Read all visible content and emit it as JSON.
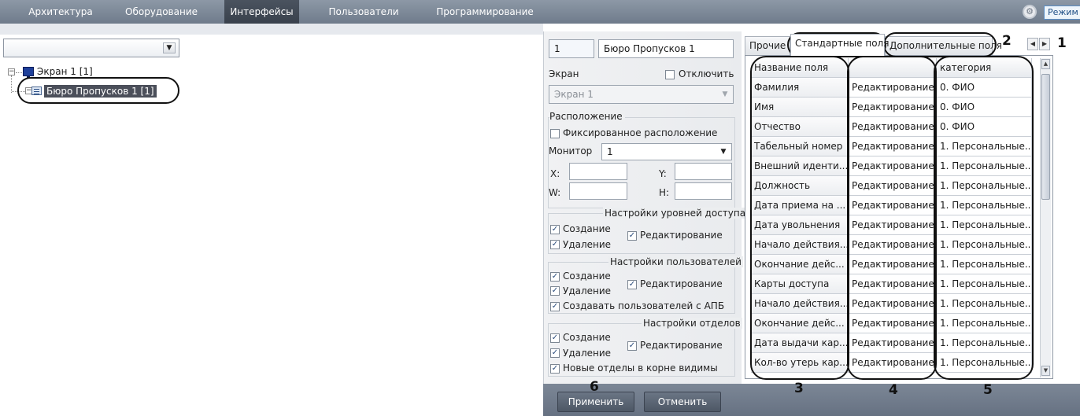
{
  "nav": {
    "tabs": [
      {
        "label": "Архитектура"
      },
      {
        "label": "Оборудование"
      },
      {
        "label": "Интерфейсы"
      },
      {
        "label": "Пользователи"
      },
      {
        "label": "Программирование"
      }
    ],
    "mode_label": "Режим",
    "mode_icon": "gear-icon"
  },
  "tree": {
    "combo_value": "",
    "items": [
      {
        "label": "Экран 1 [1]",
        "icon": "screen-icon"
      },
      {
        "label": "Бюро Пропусков 1 [1]",
        "icon": "list-icon"
      }
    ]
  },
  "settings": {
    "id_value": "1",
    "name_value": "Бюро Пропусков 1",
    "screen_label": "Экран",
    "disable_label": "Отключить",
    "screen_value": "Экран 1",
    "location_group": "Расположение",
    "fixed_location_label": "Фиксированное расположение",
    "monitor_label": "Монитор",
    "monitor_value": "1",
    "x_label": "X:",
    "y_label": "Y:",
    "w_label": "W:",
    "h_label": "H:",
    "access_group": "Настройки уровней доступа",
    "users_group": "Настройки пользователей",
    "departments_group": "Настройки отделов",
    "create_label": "Создание",
    "delete_label": "Удаление",
    "edit_label": "Редактирование",
    "create_users_apb_label": "Создавать пользователей с АПБ",
    "new_departments_root_label": "Новые отделы в корне видимы",
    "apply_label": "Применить",
    "cancel_label": "Отменить"
  },
  "tabs": {
    "items": [
      {
        "label": "Прочие"
      },
      {
        "label": "Стандартные поля"
      },
      {
        "label": "Дополнительные поля"
      }
    ],
    "active": "Стандартные поля"
  },
  "table": {
    "columns": [
      "Название поля",
      "",
      "категория"
    ],
    "rows": [
      {
        "name": "Фамилия",
        "mode": "Редактирование",
        "category": "0. ФИО"
      },
      {
        "name": "Имя",
        "mode": "Редактирование",
        "category": "0. ФИО"
      },
      {
        "name": "Отчество",
        "mode": "Редактирование",
        "category": "0. ФИО"
      },
      {
        "name": "Табельный номер",
        "mode": "Редактирование",
        "category": "1. Персональные..."
      },
      {
        "name": "Внешний иденти...",
        "mode": "Редактирование",
        "category": "1. Персональные..."
      },
      {
        "name": "Должность",
        "mode": "Редактирование",
        "category": "1. Персональные..."
      },
      {
        "name": "Дата приема на ...",
        "mode": "Редактирование",
        "category": "1. Персональные..."
      },
      {
        "name": "Дата увольнения",
        "mode": "Редактирование",
        "category": "1. Персональные..."
      },
      {
        "name": "Начало действия...",
        "mode": "Редактирование",
        "category": "1. Персональные..."
      },
      {
        "name": "Окончание дейс...",
        "mode": "Редактирование",
        "category": "1. Персональные..."
      },
      {
        "name": "Карты доступа",
        "mode": "Редактирование",
        "category": "1. Персональные..."
      },
      {
        "name": "Начало действия...",
        "mode": "Редактирование",
        "category": "1. Персональные..."
      },
      {
        "name": "Окончание дейс...",
        "mode": "Редактирование",
        "category": "1. Персональные..."
      },
      {
        "name": "Дата выдачи кар...",
        "mode": "Редактирование",
        "category": "1. Персональные..."
      },
      {
        "name": "Кол-во утерь кар...",
        "mode": "Редактирование",
        "category": "1. Персональные..."
      }
    ]
  },
  "callouts": [
    "1",
    "2",
    "3",
    "4",
    "5",
    "6"
  ]
}
